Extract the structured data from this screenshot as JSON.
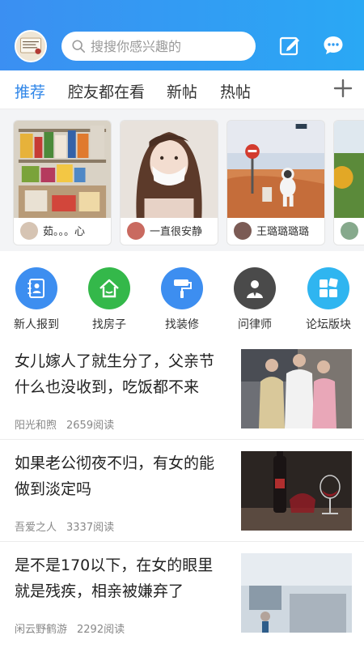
{
  "header": {
    "search_placeholder": "搜搜你感兴趣的",
    "avatar_icon": "user-avatar",
    "compose_icon": "edit-icon",
    "message_icon": "chat-bubble-icon",
    "brand_color": "#3b8ff2"
  },
  "tabs": [
    {
      "label": "推荐",
      "active": true
    },
    {
      "label": "腔友都在看",
      "active": false
    },
    {
      "label": "新帖",
      "active": false
    },
    {
      "label": "热帖",
      "active": false
    }
  ],
  "stories": [
    {
      "name": "茹。。。心"
    },
    {
      "name": "一直很安静"
    },
    {
      "name": "王璐璐璐璐"
    },
    {
      "name": ""
    }
  ],
  "quick_entries": [
    {
      "label": "新人报到",
      "icon": "address-book-icon",
      "color": "#3d8ef0"
    },
    {
      "label": "找房子",
      "icon": "house-icon",
      "color": "#34b84a"
    },
    {
      "label": "找装修",
      "icon": "paint-roller-icon",
      "color": "#3d8ef0"
    },
    {
      "label": "问律师",
      "icon": "lawyer-icon",
      "color": "#4a4a4a"
    },
    {
      "label": "论坛版块",
      "icon": "grid-blocks-icon",
      "color": "#2fb5f0"
    }
  ],
  "posts": [
    {
      "title": "女儿嫁人了就生分了，父亲节什么也没收到，吃饭都不来",
      "author": "阳光和煦",
      "reads": "2659阅读"
    },
    {
      "title": "如果老公彻夜不归，有女的能做到淡定吗",
      "author": "吾爱之人",
      "reads": "3337阅读"
    },
    {
      "title": "是不是170以下，在女的眼里就是残疾，相亲被嫌弃了",
      "author": "闲云野鹤游",
      "reads": "2292阅读"
    }
  ]
}
